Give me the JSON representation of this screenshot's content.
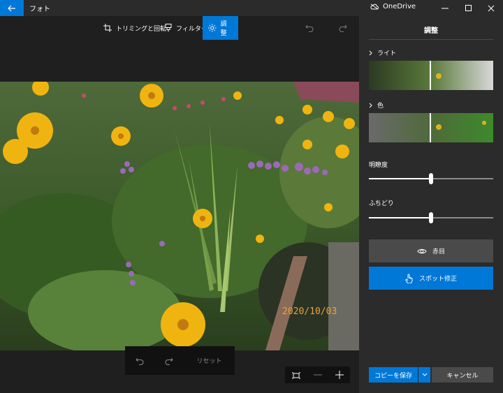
{
  "titlebar": {
    "app_title": "フォト",
    "onedrive_label": "OneDrive"
  },
  "toolbar": {
    "tabs": [
      {
        "label": "トリミングと回転",
        "icon": "crop-rotate-icon"
      },
      {
        "label": "フィルター",
        "icon": "filter-icon"
      },
      {
        "label": "調整",
        "icon": "brightness-icon",
        "active": true
      }
    ]
  },
  "photo": {
    "timestamp": "2020/10/03"
  },
  "edit_bar": {
    "reset_label": "リセット"
  },
  "panel": {
    "title": "調整",
    "sections": [
      {
        "label": "ライト"
      },
      {
        "label": "色"
      }
    ],
    "sliders": [
      {
        "label": "明瞭度",
        "value": 0.5
      },
      {
        "label": "ふちどり",
        "value": 0.5
      }
    ],
    "red_eye_label": "赤目",
    "spot_fix_label": "スポット修正",
    "save_copy_label": "コピーを保存",
    "cancel_label": "キャンセル"
  },
  "colors": {
    "accent": "#0078d7",
    "panel_bg": "#2b2b2b",
    "app_bg": "#1f1f1f",
    "button_gray": "#4a4a4a"
  }
}
